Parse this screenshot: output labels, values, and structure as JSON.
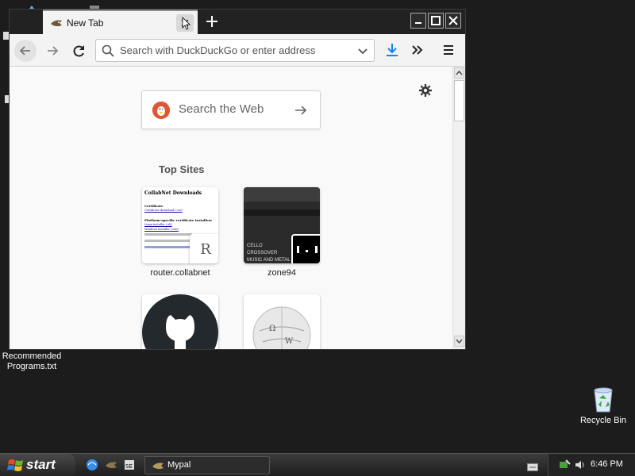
{
  "desktop": {
    "icons": [
      {
        "label": "Recommended\nPrograms.txt"
      },
      {
        "label": "Recycle Bin"
      }
    ]
  },
  "browser": {
    "tab": {
      "title": "New Tab"
    },
    "toolbar": {
      "back": "back-icon",
      "forward": "forward-icon",
      "reload": "reload-icon",
      "url_placeholder": "Search with DuckDuckGo or enter address",
      "download": "download-icon",
      "overflow": "chevron-double-right-icon",
      "menu": "hamburger-icon"
    },
    "newtab": {
      "search_label": "Search the Web",
      "topsites_heading": "Top Sites",
      "sites": [
        {
          "label": "router.collabnet",
          "badge": "R"
        },
        {
          "label": "zone94"
        },
        {
          "label": ""
        },
        {
          "label": ""
        }
      ],
      "collabnet_preview": {
        "title": "CollabNet Downloads",
        "section1": "Certificate",
        "link1": "Certificate download (.cer)",
        "section2": "Platform-specific certificate installers",
        "items": [
          "Linux installer (.sh)",
          "Windows installer (.exe)"
        ]
      },
      "zone94_preview": {
        "heading": "CELLO CROSSOVER MUSIC AND METAL"
      }
    }
  },
  "taskbar": {
    "start_label": "start",
    "task": "Mypal",
    "clock": "6:46 PM"
  },
  "colors": {
    "accent_download": "#0a84ff",
    "ddg": "#de5833",
    "github": "#24292e"
  }
}
